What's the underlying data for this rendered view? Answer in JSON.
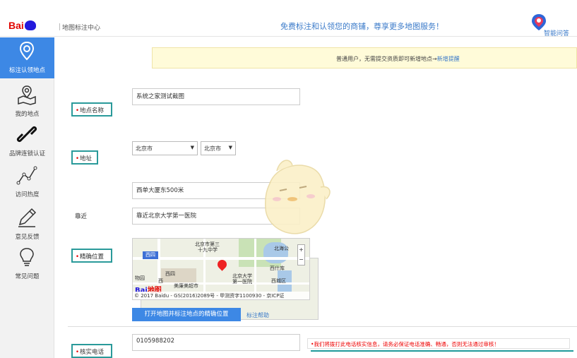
{
  "header": {
    "logo_bai": "Bai",
    "logo_du": "du",
    "logo_map": "地图",
    "center_title": "地图标注中心",
    "promo": "免费标注和认领您的商铺，尊享更多地图服务！",
    "assistant_label": "智能问答"
  },
  "sidebar": {
    "items": [
      {
        "label": "标注认领地点",
        "icon": "location-pin-icon",
        "active": true
      },
      {
        "label": "我的地点",
        "icon": "my-places-map-icon"
      },
      {
        "label": "品牌连锁认证",
        "icon": "chain-link-icon"
      },
      {
        "label": "访问热度",
        "icon": "trend-line-icon"
      },
      {
        "label": "意见反馈",
        "icon": "pencil-icon"
      },
      {
        "label": "常见问题",
        "icon": "lightbulb-icon"
      }
    ]
  },
  "notice": {
    "text": "普通用户，无需提交资质即可新增地点→",
    "link": "新增提醒"
  },
  "form": {
    "name_label": "地点名称",
    "name_value": "系统之家测试截图",
    "address_label": "地址",
    "province": "北京市",
    "city": "北京市",
    "street_value": "西单大厦东500米",
    "nearby_label": "靠近",
    "nearby_value": "靠近北京大学第一医院",
    "location_label": "精确位置",
    "phone_label": "核实电话",
    "phone_value": "0105988202"
  },
  "map": {
    "poi_1": "北京市第三",
    "poi_1b": "十九中学",
    "poi_2": "西四",
    "poi_3": "北京大学",
    "poi_3b": "第一医院",
    "poi_4": "西什库",
    "poi_5": "美廉美超市",
    "poi_6": "北海公",
    "poi_7": "西城区",
    "poi_8": "物园",
    "poi_9": "西",
    "copyright": "© 2017 Baidu - GS(2016)2089号 - 甲测资字1100930 - 京ICP证",
    "zoom_in": "+",
    "zoom_out": "−"
  },
  "actions": {
    "open_map_button": "打开地图并标注地点的精确位置",
    "help_link": "标注帮助"
  },
  "warning": {
    "text": "•我们将拨打此电话核实信息，请务必保证电话准确、畅通，否则无法通过审核！"
  },
  "colors": {
    "accent": "#3d88e5",
    "label_border": "#2a9a9a",
    "required": "#e60000",
    "notice_bg": "#fffbd9"
  }
}
